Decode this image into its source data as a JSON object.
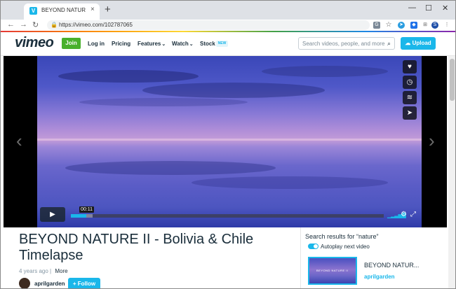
{
  "browser": {
    "tab_title": "BEYOND NATURE II - Bo",
    "url": "https://vimeo.com/102787065",
    "profile_initial": "S",
    "favicon_letter": "V"
  },
  "header": {
    "logo": "vimeo",
    "join": "Join",
    "nav": [
      "Log in",
      "Pricing",
      "Features",
      "Watch",
      "Stock"
    ],
    "new_badge": "NEW",
    "search_placeholder": "Search videos, people, and more",
    "upload": "Upload"
  },
  "player": {
    "timecode": "00:11",
    "progress_fraction": 0.05
  },
  "video": {
    "title": "BEYOND NATURE II - Bolivia & Chile Timelapse",
    "age": "4 years ago",
    "separator": "|",
    "more": "More",
    "author": "aprilgarden",
    "follow": "+ Follow"
  },
  "sidebar": {
    "results_title": "Search results for “nature”",
    "autoplay_label": "Autoplay next video",
    "next_video_title": "BEYOND NATUR...",
    "next_video_author": "aprilgarden",
    "thumb_text": "BEYOND NATURE II"
  },
  "colors": {
    "accent": "#1ab7ea",
    "join_green": "#48b02c",
    "text_dark": "#1a2e3b"
  }
}
